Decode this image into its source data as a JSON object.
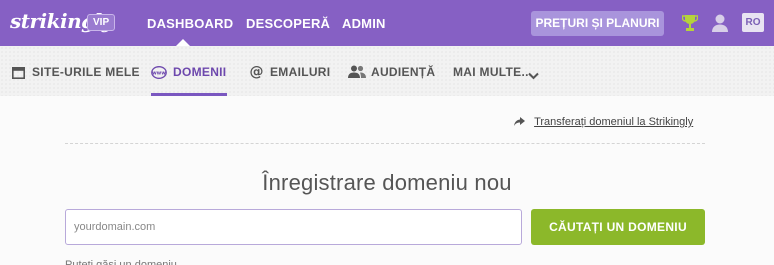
{
  "header": {
    "logo": "strikingly",
    "badge": "VIP",
    "nav": [
      "DASHBOARD",
      "DESCOPERĂ",
      "ADMIN"
    ],
    "pricing_button": "PREȚURI ȘI PLANURI",
    "language": "RO"
  },
  "subnav": {
    "items": [
      "SITE-URILE MELE",
      "DOMENII",
      "EMAILURI",
      "AUDIENȚĂ",
      "MAI MULTE..."
    ],
    "active": "DOMENII"
  },
  "main": {
    "transfer_link": "Transferați domeniul la Strikingly",
    "title": "Înregistrare domeniu nou",
    "search_placeholder": "yourdomain.com",
    "search_button": "CĂUTAȚI UN DOMENIU",
    "cutoff_text": "Puteți găsi un domeniu"
  },
  "colors": {
    "brand": "#8660c4",
    "accent_green": "#8cb82a",
    "active_tab": "#6d48ad"
  },
  "icons": {
    "trophy": "trophy-icon",
    "user": "user-icon",
    "sites": "browser-window-icon",
    "domains": "www-globe-icon",
    "emails": "at-sign-icon",
    "audience": "users-icon",
    "more": "chevron-down-icon",
    "transfer": "share-arrow-icon"
  }
}
